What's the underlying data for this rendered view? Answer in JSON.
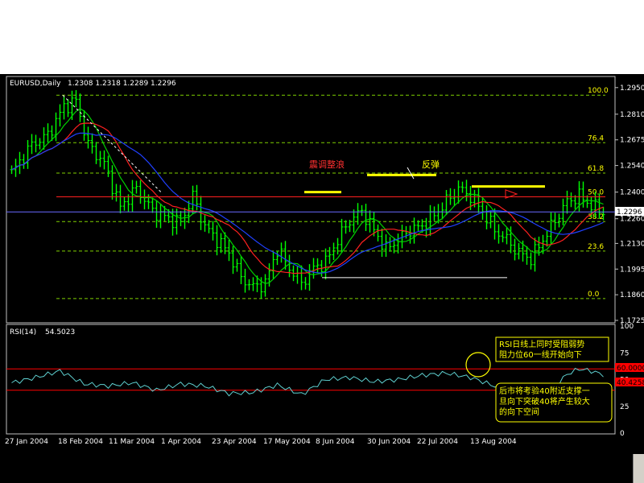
{
  "chart_data": [
    {
      "type": "candlestick",
      "symbol_header": "EURUSD,Daily",
      "ohlc_header": "1.2308 1.2318 1.2289 1.2296",
      "current_price_label": "1.2296",
      "ylim": [
        1.1725,
        1.3
      ],
      "y_ticks": [
        "1.2950",
        "1.2810",
        "1.2675",
        "1.2540",
        "1.2400",
        "1.2260",
        "1.2130",
        "1.1995",
        "1.1860",
        "1.1725"
      ],
      "x_ticks": [
        "27 Jan 2004",
        "18 Feb 2004",
        "11 Mar 2004",
        "1 Apr 2004",
        "23 Apr 2004",
        "17 May 2004",
        "8 Jun 2004",
        "30 Jun 2004",
        "22 Jul 2004",
        "13 Aug 2004"
      ],
      "fibonacci_levels": [
        {
          "label": "100.0",
          "price": 1.291
        },
        {
          "label": "76.4",
          "price": 1.266
        },
        {
          "label": "61.8",
          "price": 1.25
        },
        {
          "label": "50.0",
          "price": 1.2375
        },
        {
          "label": "38.2",
          "price": 1.2245
        },
        {
          "label": "23.6",
          "price": 1.209
        },
        {
          "label": "0.0",
          "price": 1.184
        }
      ],
      "annotations": [
        {
          "text": "震调整浪",
          "color": "#ff3030"
        },
        {
          "text": "反弹",
          "color": "#ffff00"
        }
      ],
      "close_path": [
        {
          "i": 0,
          "c": 1.25
        },
        {
          "i": 5,
          "c": 1.265
        },
        {
          "i": 9,
          "c": 1.27
        },
        {
          "i": 13,
          "c": 1.285
        },
        {
          "i": 16,
          "c": 1.288
        },
        {
          "i": 19,
          "c": 1.265
        },
        {
          "i": 23,
          "c": 1.255
        },
        {
          "i": 27,
          "c": 1.232
        },
        {
          "i": 31,
          "c": 1.242
        },
        {
          "i": 35,
          "c": 1.23
        },
        {
          "i": 39,
          "c": 1.226
        },
        {
          "i": 42,
          "c": 1.224
        },
        {
          "i": 45,
          "c": 1.238
        },
        {
          "i": 48,
          "c": 1.222
        },
        {
          "i": 51,
          "c": 1.215
        },
        {
          "i": 54,
          "c": 1.208
        },
        {
          "i": 57,
          "c": 1.195
        },
        {
          "i": 60,
          "c": 1.19
        },
        {
          "i": 63,
          "c": 1.192
        },
        {
          "i": 66,
          "c": 1.21
        },
        {
          "i": 69,
          "c": 1.2
        },
        {
          "i": 72,
          "c": 1.192
        },
        {
          "i": 75,
          "c": 1.2
        },
        {
          "i": 78,
          "c": 1.203
        },
        {
          "i": 81,
          "c": 1.215
        },
        {
          "i": 84,
          "c": 1.225
        },
        {
          "i": 87,
          "c": 1.23
        },
        {
          "i": 90,
          "c": 1.22
        },
        {
          "i": 93,
          "c": 1.21
        },
        {
          "i": 96,
          "c": 1.215
        },
        {
          "i": 99,
          "c": 1.22
        },
        {
          "i": 102,
          "c": 1.222
        },
        {
          "i": 105,
          "c": 1.228
        },
        {
          "i": 108,
          "c": 1.235
        },
        {
          "i": 111,
          "c": 1.242
        },
        {
          "i": 114,
          "c": 1.238
        },
        {
          "i": 117,
          "c": 1.23
        },
        {
          "i": 120,
          "c": 1.22
        },
        {
          "i": 123,
          "c": 1.215
        },
        {
          "i": 126,
          "c": 1.208
        },
        {
          "i": 129,
          "c": 1.205
        },
        {
          "i": 132,
          "c": 1.215
        },
        {
          "i": 135,
          "c": 1.225
        },
        {
          "i": 138,
          "c": 1.235
        },
        {
          "i": 141,
          "c": 1.238
        },
        {
          "i": 144,
          "c": 1.233
        },
        {
          "i": 147,
          "c": 1.2296
        }
      ]
    },
    {
      "type": "line",
      "title": "RSI(14)",
      "value_label": "54.5023",
      "ylim": [
        0,
        100
      ],
      "y_ticks": [
        "100",
        "75",
        "50",
        "25",
        "0"
      ],
      "reference_levels": [
        60,
        40
      ],
      "reference_labels": [
        "60.0000",
        "40.4258"
      ],
      "notes": [
        [
          "RSI日线上同时受阻弱势",
          "阻力位60一线开始向下"
        ],
        [
          "后市将考验40附近支撑一",
          "旦向下突破40将产生较大",
          "的向下空间"
        ]
      ],
      "rsi_path": [
        {
          "i": 0,
          "v": 47
        },
        {
          "i": 6,
          "v": 52
        },
        {
          "i": 12,
          "v": 58
        },
        {
          "i": 18,
          "v": 46
        },
        {
          "i": 24,
          "v": 44
        },
        {
          "i": 30,
          "v": 47
        },
        {
          "i": 36,
          "v": 40
        },
        {
          "i": 42,
          "v": 46
        },
        {
          "i": 48,
          "v": 44
        },
        {
          "i": 54,
          "v": 37
        },
        {
          "i": 60,
          "v": 38
        },
        {
          "i": 66,
          "v": 45
        },
        {
          "i": 72,
          "v": 36
        },
        {
          "i": 78,
          "v": 50
        },
        {
          "i": 84,
          "v": 52
        },
        {
          "i": 90,
          "v": 48
        },
        {
          "i": 96,
          "v": 50
        },
        {
          "i": 102,
          "v": 54
        },
        {
          "i": 108,
          "v": 56
        },
        {
          "i": 114,
          "v": 52
        },
        {
          "i": 120,
          "v": 44
        },
        {
          "i": 126,
          "v": 30
        },
        {
          "i": 132,
          "v": 32
        },
        {
          "i": 138,
          "v": 55
        },
        {
          "i": 141,
          "v": 60
        },
        {
          "i": 144,
          "v": 58
        },
        {
          "i": 147,
          "v": 54.5
        }
      ]
    }
  ]
}
